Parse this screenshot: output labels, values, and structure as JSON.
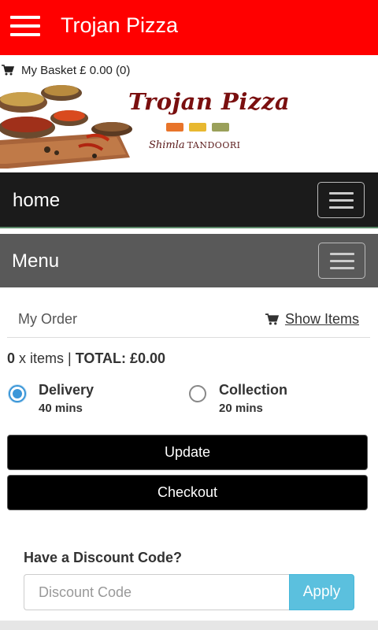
{
  "appbar": {
    "title": "Trojan Pizza",
    "menu_icon": "hamburger-icon",
    "color": "#ff0000"
  },
  "basket": {
    "icon": "cart-icon",
    "label": "My Basket £ 0.00 (0)"
  },
  "banner": {
    "title": "Trojan Pizza",
    "subtitle_script": "Shimla",
    "subtitle_caps": "TANDOORI",
    "swatch_colors": [
      "#e8742a",
      "#e8b830",
      "#9aa05a"
    ]
  },
  "nav": {
    "label": "home",
    "toggle_icon": "menu-toggle-icon"
  },
  "menu": {
    "label": "Menu",
    "toggle_icon": "menu-toggle-icon"
  },
  "order": {
    "title": "My Order",
    "show_items": "Show Items",
    "item_count": "0",
    "items_text": " x items | ",
    "total_text": "TOTAL: £0.00"
  },
  "fulfilment": {
    "delivery": {
      "label": "Delivery",
      "time": "40 mins",
      "selected": true
    },
    "collection": {
      "label": "Collection",
      "time": "20 mins",
      "selected": false
    }
  },
  "buttons": {
    "update": "Update",
    "checkout": "Checkout"
  },
  "discount": {
    "heading": "Have a Discount Code?",
    "placeholder": "Discount Code",
    "value": "",
    "apply": "Apply"
  },
  "colors": {
    "accent_blue": "#5bc0de",
    "radio_blue": "#3a96d8",
    "nav_dark": "#1b1b1b",
    "menu_gray": "#595959"
  }
}
